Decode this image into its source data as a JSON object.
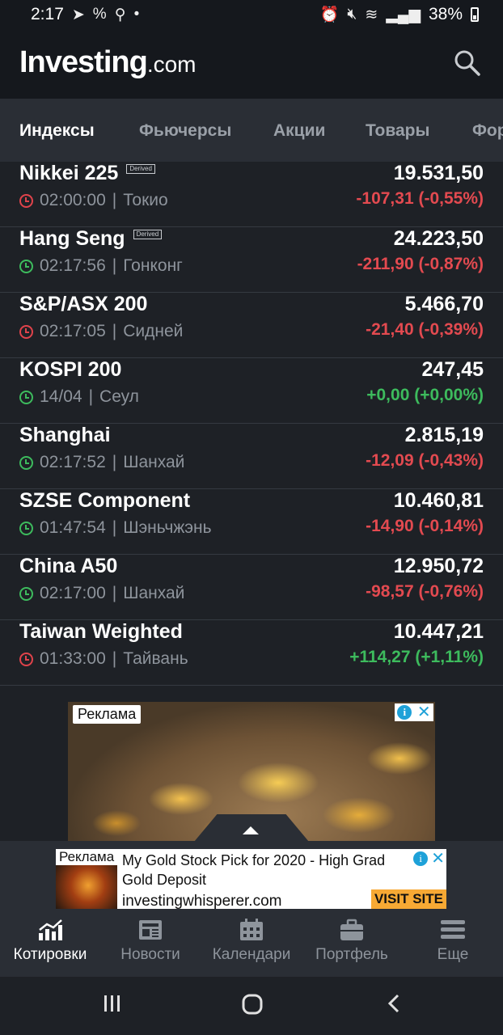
{
  "status_bar": {
    "time": "2:17",
    "battery": "38%"
  },
  "header": {
    "logo_main": "Investing",
    "logo_suffix": ".com"
  },
  "tabs": [
    {
      "label": "Индексы",
      "active": true
    },
    {
      "label": "Фьючерсы",
      "active": false
    },
    {
      "label": "Акции",
      "active": false
    },
    {
      "label": "Товары",
      "active": false
    },
    {
      "label": "Фор",
      "active": false
    }
  ],
  "rows": [
    {
      "name": "Nikkei 225",
      "derived": "Derived",
      "time": "02:00:00",
      "place": "Токио",
      "price": "19.531,50",
      "change": "-107,31 (-0,55%)",
      "status": "closed",
      "direction": "neg"
    },
    {
      "name": "Hang Seng",
      "derived": "Derived",
      "time": "02:17:56",
      "place": "Гонконг",
      "price": "24.223,50",
      "change": "-211,90 (-0,87%)",
      "status": "open",
      "direction": "neg"
    },
    {
      "name": "S&P/ASX 200",
      "derived": "",
      "time": "02:17:05",
      "place": "Сидней",
      "price": "5.466,70",
      "change": "-21,40 (-0,39%)",
      "status": "closed",
      "direction": "neg"
    },
    {
      "name": "KOSPI 200",
      "derived": "",
      "time": "14/04",
      "place": "Сеул",
      "price": "247,45",
      "change": "+0,00 (+0,00%)",
      "status": "open",
      "direction": "pos"
    },
    {
      "name": "Shanghai",
      "derived": "",
      "time": "02:17:52",
      "place": "Шанхай",
      "price": "2.815,19",
      "change": "-12,09 (-0,43%)",
      "status": "open",
      "direction": "neg"
    },
    {
      "name": "SZSE Component",
      "derived": "",
      "time": "01:47:54",
      "place": "Шэньчжэнь",
      "price": "10.460,81",
      "change": "-14,90 (-0,14%)",
      "status": "open",
      "direction": "neg"
    },
    {
      "name": "China A50",
      "derived": "",
      "time": "02:17:00",
      "place": "Шанхай",
      "price": "12.950,72",
      "change": "-98,57 (-0,76%)",
      "status": "open",
      "direction": "neg"
    },
    {
      "name": "Taiwan Weighted",
      "derived": "",
      "time": "01:33:00",
      "place": "Тайвань",
      "price": "10.447,21",
      "change": "+114,27 (+1,11%)",
      "status": "closed",
      "direction": "pos"
    }
  ],
  "ad_big": {
    "label": "Реклама"
  },
  "ad_small": {
    "label": "Реклама",
    "title": "My Gold Stock Pick for 2020 - High Grad Gold Deposit",
    "url": "investingwhisperer.com",
    "cta": "VISIT SITE"
  },
  "bottom_nav": [
    {
      "label": "Котировки",
      "icon": "chart-icon",
      "active": true
    },
    {
      "label": "Новости",
      "icon": "news-icon",
      "active": false
    },
    {
      "label": "Календари",
      "icon": "calendar-icon",
      "active": false
    },
    {
      "label": "Портфель",
      "icon": "briefcase-icon",
      "active": false
    },
    {
      "label": "Еще",
      "icon": "menu-icon",
      "active": false
    }
  ],
  "colors": {
    "negative": "#e34a50",
    "positive": "#3dbb5d",
    "background": "#1e2126",
    "header": "#15181d",
    "tab_bar": "#2a2e35"
  }
}
